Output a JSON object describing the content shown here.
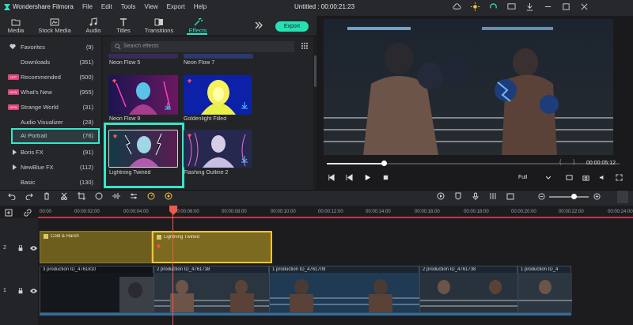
{
  "app": {
    "name": "Wondershare Filmora",
    "window_title": "Untitled : 00:00:21:23",
    "menu": [
      "File",
      "Edit",
      "Tools",
      "View",
      "Export",
      "Help"
    ]
  },
  "tabs": [
    {
      "label": "Media"
    },
    {
      "label": "Stock Media"
    },
    {
      "label": "Audio"
    },
    {
      "label": "Titles"
    },
    {
      "label": "Transitions"
    },
    {
      "label": "Effects",
      "active": true
    }
  ],
  "export_label": "Export",
  "sidebar": {
    "items": [
      {
        "label": "Favorites",
        "count": "(9)"
      },
      {
        "label": "Downloads",
        "count": "(351)"
      },
      {
        "label": "Recommended",
        "count": "(500)",
        "badge": "HOT"
      },
      {
        "label": "What's New",
        "count": "(955)",
        "badge": "NEW"
      },
      {
        "label": "Strange World",
        "count": "(31)",
        "badge": "NEW"
      },
      {
        "label": "Audio Visualizer",
        "count": "(28)"
      },
      {
        "label": "AI Portrait",
        "count": "(76)",
        "selected": true
      },
      {
        "label": "Boris FX",
        "count": "(91)"
      },
      {
        "label": "NewBlue FX",
        "count": "(112)"
      },
      {
        "label": "Basic",
        "count": "(130)"
      }
    ]
  },
  "search": {
    "placeholder": "Search effects"
  },
  "effects": {
    "items": [
      {
        "label": "Neon Flow 5"
      },
      {
        "label": "Neon Flow 7"
      },
      {
        "label": "Neon Flow 9"
      },
      {
        "label": "Goldenlight Filled"
      },
      {
        "label": "Lightning Twined",
        "selected": true
      },
      {
        "label": "Flashing Outline 2"
      }
    ]
  },
  "player": {
    "time": "00:00:05:12",
    "quality": "Full"
  },
  "timeline": {
    "ruler": [
      "00:00",
      "00:00:02:00",
      "00:00:04:00",
      "00:00:06:00",
      "00:00:08:00",
      "00:00:10:00",
      "00:00:12:00",
      "00:00:14:00",
      "00:00:16:00",
      "00:00:18:00",
      "00:00:20:00",
      "00:00:22:00",
      "00:00:24:00"
    ],
    "effect_clips": [
      {
        "label": "Cold & Harsh"
      },
      {
        "label": "Lightning Twined"
      }
    ],
    "video_clips": [
      {
        "label": "3 production ID_4761810"
      },
      {
        "label": "2 production ID_4761738"
      },
      {
        "label": "1 production ID_4761709"
      },
      {
        "label": "2 production ID_4761738"
      },
      {
        "label": "1 production ID_4"
      }
    ],
    "track_labels": [
      "2",
      "1"
    ]
  },
  "colors": {
    "accent": "#2ee3c2",
    "highlight": "#37e6c8",
    "effect_clip": "#7b6a20",
    "selected_clip_border": "#f1c531",
    "playhead": "#f05a4a"
  }
}
